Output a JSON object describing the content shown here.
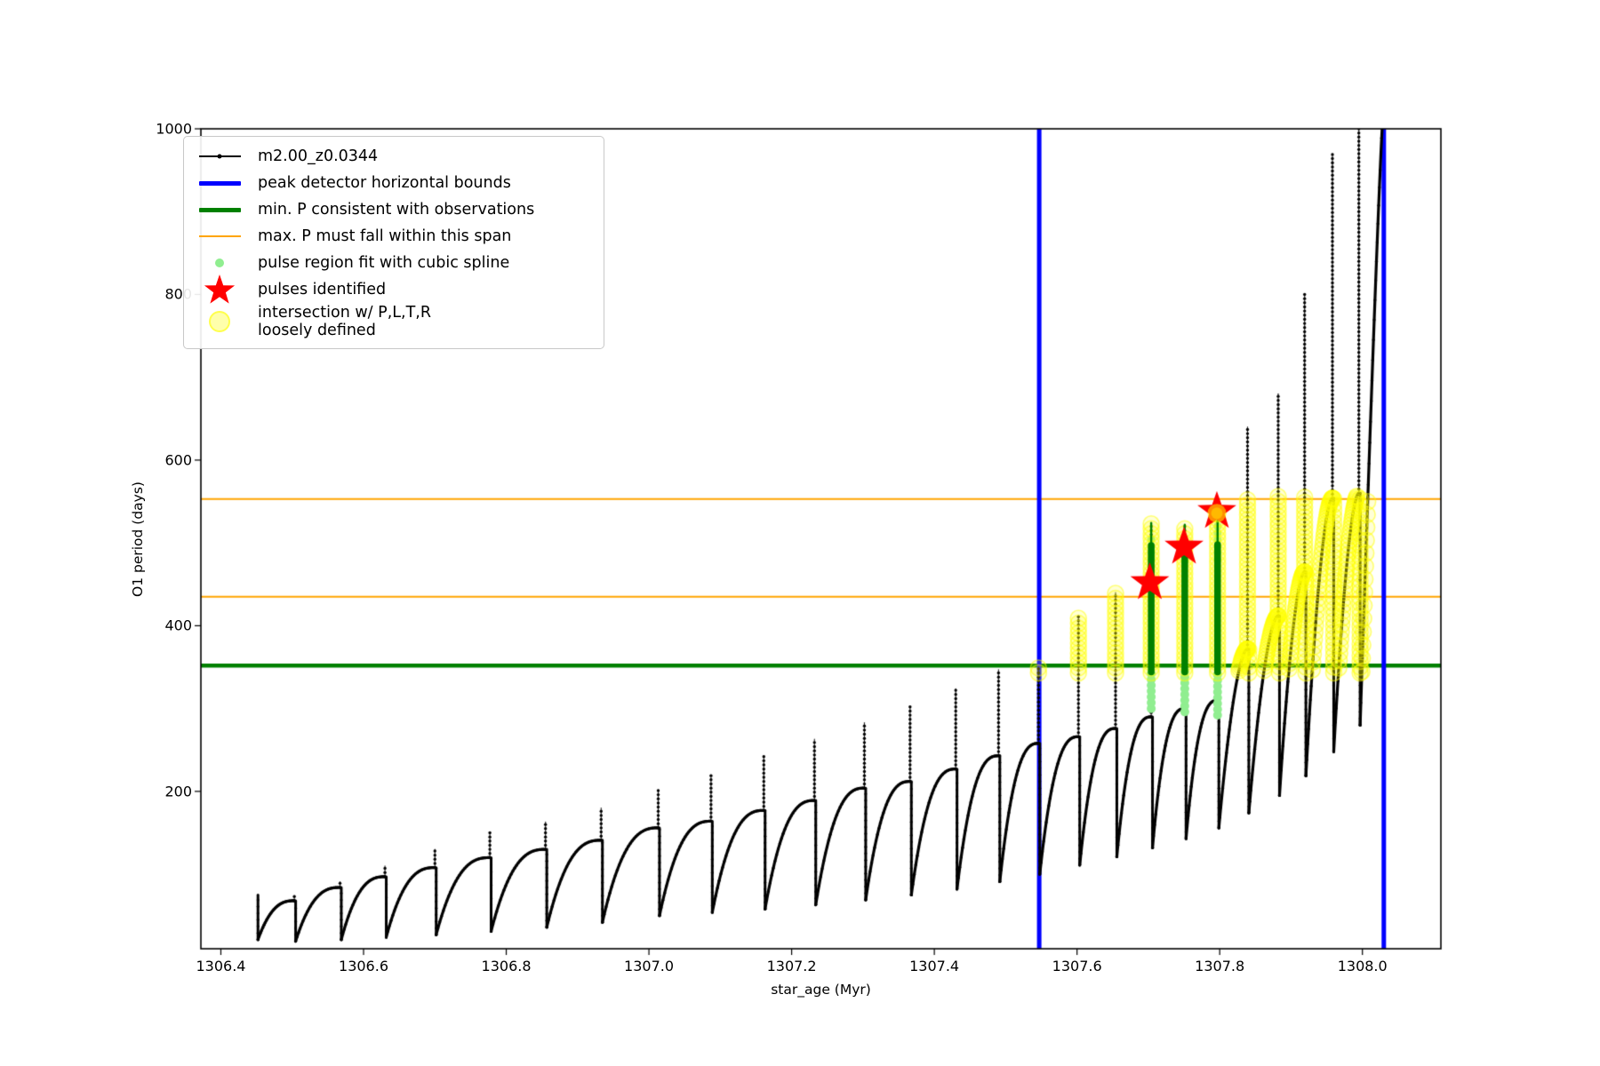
{
  "chart_data": {
    "type": "line",
    "title": "",
    "xlabel": "star_age (Myr)",
    "ylabel": "O1 period (days)",
    "xlim": [
      1306.372,
      1308.11
    ],
    "ylim": [
      10,
      1000
    ],
    "grid": false,
    "xticks": [
      {
        "value": 1306.4,
        "label": "1306.4"
      },
      {
        "value": 1306.6,
        "label": "1306.6"
      },
      {
        "value": 1306.8,
        "label": "1306.8"
      },
      {
        "value": 1307.0,
        "label": "1307.0"
      },
      {
        "value": 1307.2,
        "label": "1307.2"
      },
      {
        "value": 1307.4,
        "label": "1307.4"
      },
      {
        "value": 1307.6,
        "label": "1307.6"
      },
      {
        "value": 1307.8,
        "label": "1307.8"
      },
      {
        "value": 1308.0,
        "label": "1308.0"
      }
    ],
    "yticks": [
      {
        "value": 200,
        "label": "200"
      },
      {
        "value": 400,
        "label": "400"
      },
      {
        "value": 600,
        "label": "600"
      },
      {
        "value": 800,
        "label": "800"
      },
      {
        "value": 1000,
        "label": "1000"
      }
    ],
    "colors": {
      "series": "#000000",
      "bounds": "#0000ff",
      "min_p": "#008000",
      "max_p": "#ffa500",
      "spline_fit": "#008000",
      "pulse_region": "#90ee90",
      "pulses": "#ff0000",
      "intersection": "#ffff00"
    },
    "legend": {
      "position": "upper left",
      "entries": [
        {
          "label": "m2.00_z0.0344",
          "handle": "line-dot",
          "color": "#000000"
        },
        {
          "label": "peak detector horizontal bounds",
          "handle": "thick-line",
          "color": "#0000ff"
        },
        {
          "label": "min. P consistent with observations",
          "handle": "thick-line",
          "color": "#008000"
        },
        {
          "label": "max. P must fall within this span",
          "handle": "line",
          "color": "#ffa500"
        },
        {
          "label": "pulse region fit with cubic spline",
          "handle": "dot",
          "color": "#90ee90"
        },
        {
          "label": "pulses identified",
          "handle": "star",
          "color": "#ff0000"
        },
        {
          "label": "intersection w/ P,L,T,R",
          "label2": "loosely defined",
          "handle": "big-dot",
          "color": "#ffff00"
        }
      ]
    },
    "vlines": [
      {
        "x": 1307.547,
        "color": "#0000ff"
      },
      {
        "x": 1308.03,
        "color": "#0000ff"
      }
    ],
    "hlines": [
      {
        "y": 352,
        "color": "#008000",
        "role": "min_p"
      },
      {
        "y": 435,
        "color": "#ffa500",
        "role": "max_p_low"
      },
      {
        "y": 553,
        "color": "#ffa500",
        "role": "max_p_high"
      }
    ],
    "pulses_identified": [
      {
        "x": 1307.702,
        "y": 452
      },
      {
        "x": 1307.75,
        "y": 495
      },
      {
        "x": 1307.796,
        "y": 538
      }
    ],
    "spline_segments": [
      {
        "x": 1307.704,
        "bar": [
          344,
          497
        ],
        "tip": 524,
        "region_dots": [
          300,
          345
        ],
        "tip_dots": [
          472,
          505
        ]
      },
      {
        "x": 1307.751,
        "bar": [
          344,
          494
        ],
        "tip": 522,
        "region_dots": [
          296,
          345
        ],
        "tip_dots": [
          478,
          508
        ]
      },
      {
        "x": 1307.797,
        "bar": [
          344,
          498
        ],
        "tip": 527,
        "region_dots": [
          292,
          345
        ],
        "tip_dots": [
          480,
          522
        ]
      }
    ],
    "intersection_band": {
      "x_range": [
        1307.541,
        1308.046
      ],
      "y_range": [
        343,
        557
      ]
    },
    "series": {
      "name": "m2.00_z0.0344",
      "color": "#000000",
      "start": {
        "x": 1306.452,
        "v": 75
      },
      "pulse_cycles": [
        {
          "xs": 1306.503,
          "vmin": 21,
          "vp": 68,
          "vs": 74
        },
        {
          "xs": 1306.567,
          "vmin": 19,
          "vp": 84,
          "vs": 91
        },
        {
          "xs": 1306.63,
          "vmin": 21,
          "vp": 97,
          "vs": 110
        },
        {
          "xs": 1306.7,
          "vmin": 24,
          "vp": 108,
          "vs": 130
        },
        {
          "xs": 1306.777,
          "vmin": 27,
          "vp": 120,
          "vs": 151
        },
        {
          "xs": 1306.855,
          "vmin": 31,
          "vp": 130,
          "vs": 163
        },
        {
          "xs": 1306.933,
          "vmin": 36,
          "vp": 141,
          "vs": 180
        },
        {
          "xs": 1307.013,
          "vmin": 42,
          "vp": 156,
          "vs": 202
        },
        {
          "xs": 1307.087,
          "vmin": 50,
          "vp": 164,
          "vs": 220
        },
        {
          "xs": 1307.161,
          "vmin": 54,
          "vp": 177,
          "vs": 243
        },
        {
          "xs": 1307.232,
          "vmin": 58,
          "vp": 189,
          "vs": 263
        },
        {
          "xs": 1307.302,
          "vmin": 63,
          "vp": 204,
          "vs": 283
        },
        {
          "xs": 1307.366,
          "vmin": 69,
          "vp": 212,
          "vs": 302
        },
        {
          "xs": 1307.43,
          "vmin": 75,
          "vp": 227,
          "vs": 324
        },
        {
          "xs": 1307.49,
          "vmin": 82,
          "vp": 243,
          "vs": 347
        },
        {
          "xs": 1307.546,
          "vmin": 91,
          "vp": 258,
          "vs": 350
        },
        {
          "xs": 1307.602,
          "vmin": 100,
          "vp": 266,
          "vs": 412
        },
        {
          "xs": 1307.654,
          "vmin": 111,
          "vp": 276,
          "vs": 440
        },
        {
          "xs": 1307.704,
          "vmin": 121,
          "vp": 290,
          "vs": 524
        },
        {
          "xs": 1307.751,
          "vmin": 132,
          "vp": 300,
          "vs": 522
        },
        {
          "xs": 1307.797,
          "vmin": 143,
          "vp": 310,
          "vs": 540
        },
        {
          "xs": 1307.839,
          "vmin": 156,
          "vp": 372,
          "vs": 640
        },
        {
          "xs": 1307.882,
          "vmin": 174,
          "vp": 412,
          "vs": 680
        },
        {
          "xs": 1307.919,
          "vmin": 195,
          "vp": 465,
          "vs": 800
        },
        {
          "xs": 1307.958,
          "vmin": 219,
          "vp": 554,
          "vs": 970
        },
        {
          "xs": 1307.995,
          "vmin": 248,
          "vp": 560,
          "vs": 1005
        },
        {
          "xs": 1308.028,
          "vmin": 280,
          "vp": 1005,
          "vs": 1005
        }
      ]
    }
  }
}
